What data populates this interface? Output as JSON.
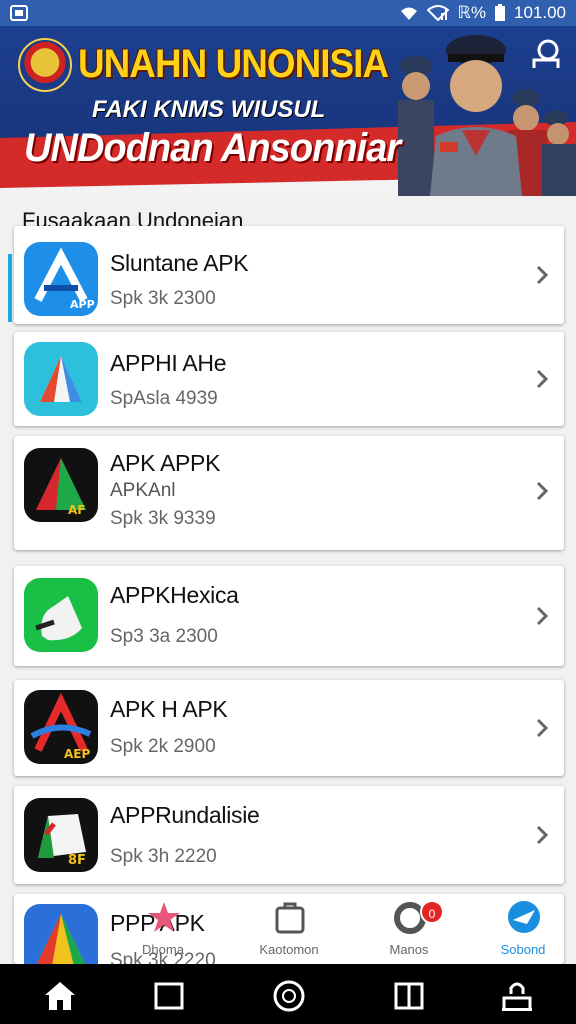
{
  "status_bar": {
    "signal_text": "ℝ%",
    "time": "101.00"
  },
  "banner": {
    "title": "UNAHN UNONISIA",
    "subtitle": "FAKI KNMS WIUSUL",
    "slogan": "UNDodnan Ansonniar",
    "colors": {
      "blue": "#1d3f8f",
      "red": "#d42a2a",
      "yellow": "#ffd21a"
    }
  },
  "section": {
    "label": "Fusaakaan Undoneian"
  },
  "apps": [
    {
      "name": "Sluntane APK",
      "sub": "",
      "meta": "Spk 3k 2300",
      "icon": "apk-a-blue-icon"
    },
    {
      "name": "APPHI AHe",
      "sub": "",
      "meta": "SpAsla 4939",
      "icon": "apk-a-teal-icon"
    },
    {
      "name": "APK APPK",
      "sub": "APKAnl",
      "meta": "Spk 3k 9339",
      "icon": "apk-a-dark-icon"
    },
    {
      "name": "APPKHexica",
      "sub": "",
      "meta": "Sp3 3a 2300",
      "icon": "apk-green-icon"
    },
    {
      "name": "APK H APK",
      "sub": "",
      "meta": "Spk 2k 2900",
      "icon": "apk-a-red-icon"
    },
    {
      "name": "APPRundalisie",
      "sub": "",
      "meta": "Spk 3h 2220",
      "icon": "apk-dark-green-icon"
    },
    {
      "name": "PPP APK",
      "sub": "",
      "meta": "Spk 3k 2220",
      "icon": "apk-a-rainbow-icon"
    }
  ],
  "tabs": [
    {
      "label": "Dhoma",
      "icon": "star-icon"
    },
    {
      "label": "Kaotomon",
      "icon": "bag-icon"
    },
    {
      "label": "Manos",
      "icon": "ring-icon",
      "badge": "0"
    },
    {
      "label": "Sobond",
      "icon": "plane-icon"
    }
  ]
}
